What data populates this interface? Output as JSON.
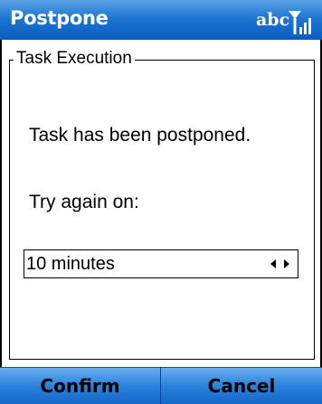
{
  "title_bar": {
    "title": "Postpone",
    "input_mode": "abc",
    "signal_icon": "signal-strength-icon",
    "colors": {
      "background": "#1f76d3",
      "text": "#ffffff"
    }
  },
  "task_group": {
    "legend": "Task Execution",
    "message": "Task has been postponed.",
    "retry_label": "Try again on:",
    "retry_select": {
      "value": "10 minutes",
      "left_arrow_icon": "arrow-left-icon",
      "right_arrow_icon": "arrow-right-icon"
    }
  },
  "softkeys": {
    "left_label": "Confirm",
    "right_label": "Cancel",
    "colors": {
      "background": "#2a82dc"
    }
  }
}
